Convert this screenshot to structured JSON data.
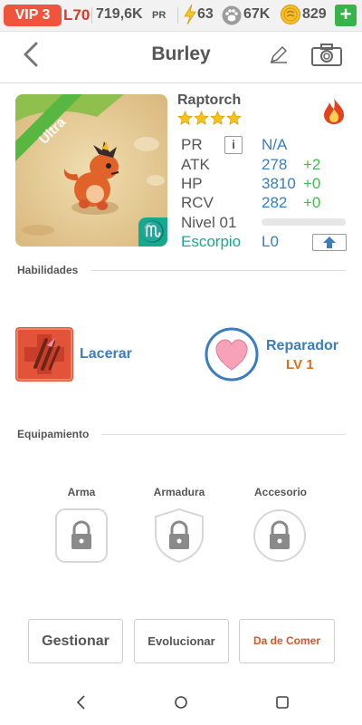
{
  "topbar": {
    "vip": "VIP 3",
    "level": "L70",
    "pr_value": "719,6K",
    "pr_label": "PR",
    "energy": "63",
    "paw": "67K",
    "coins": "829",
    "plus": "+"
  },
  "header": {
    "title": "Burley"
  },
  "pet": {
    "species": "Raptorch",
    "stars": 4,
    "badge": "Ultra",
    "zodiac_symbol": "♏",
    "stats": {
      "pr_label": "PR",
      "pr_value": "N/A",
      "info": "i",
      "atk_label": "ATK",
      "atk_value": "278",
      "atk_bonus": "+2",
      "hp_label": "HP",
      "hp_value": "3810",
      "hp_bonus": "+0",
      "rcv_label": "RCV",
      "rcv_value": "282",
      "rcv_bonus": "+0"
    },
    "level_label": "Nivel 01",
    "xp_progress": 0,
    "zodiac": "Escorpio",
    "zodiac_level": "L0"
  },
  "skills": {
    "title": "Habilidades",
    "items": [
      {
        "name": "Lacerar"
      },
      {
        "name": "Reparador",
        "level": "LV 1"
      }
    ]
  },
  "equipment": {
    "title": "Equipamiento",
    "slots": [
      {
        "label": "Arma"
      },
      {
        "label": "Armadura"
      },
      {
        "label": "Accesorio"
      }
    ]
  },
  "actions": {
    "manage": "Gestionar",
    "evolve": "Evolucionar",
    "feed": "Da de Comer"
  },
  "colors": {
    "accent_blue": "#3b7dbd",
    "bonus_green": "#42b84d",
    "zodiac_teal": "#17a98b",
    "vip_red": "#f1543c",
    "feed_orange": "#e3521f"
  }
}
